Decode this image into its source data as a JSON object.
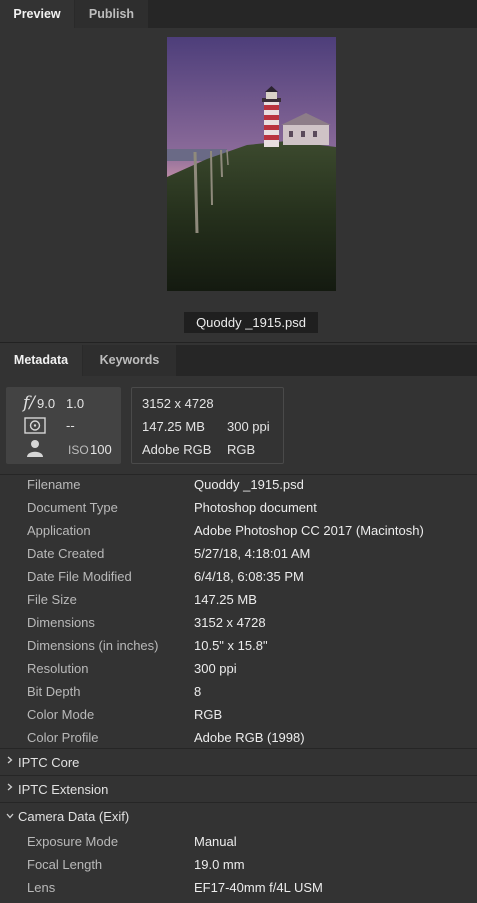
{
  "top_tabs": {
    "preview": "Preview",
    "publish": "Publish"
  },
  "preview": {
    "filename": "Quoddy _1915.psd"
  },
  "meta_tabs": {
    "metadata": "Metadata",
    "keywords": "Keywords"
  },
  "summary": {
    "fstop_icon": "f/",
    "aperture": "9.0",
    "exposure": "1.0",
    "metering": "--",
    "iso_label": "ISO",
    "iso_value": "100",
    "dimensions": "3152 x 4728",
    "size": "147.25 MB",
    "resolution": "300 ppi",
    "profile": "Adobe RGB",
    "mode": "RGB"
  },
  "file_properties": [
    {
      "key": "Filename",
      "value": "Quoddy _1915.psd"
    },
    {
      "key": "Document Type",
      "value": "Photoshop document"
    },
    {
      "key": "Application",
      "value": "Adobe Photoshop CC 2017 (Macintosh)"
    },
    {
      "key": "Date Created",
      "value": "5/27/18, 4:18:01 AM"
    },
    {
      "key": "Date File Modified",
      "value": "6/4/18, 6:08:35 PM"
    },
    {
      "key": "File Size",
      "value": "147.25 MB"
    },
    {
      "key": "Dimensions",
      "value": "3152 x 4728"
    },
    {
      "key": "Dimensions (in inches)",
      "value": "10.5\" x 15.8\""
    },
    {
      "key": "Resolution",
      "value": "300 ppi"
    },
    {
      "key": "Bit Depth",
      "value": "8"
    },
    {
      "key": "Color Mode",
      "value": "RGB"
    },
    {
      "key": "Color Profile",
      "value": "Adobe RGB (1998)"
    }
  ],
  "sections": {
    "iptc_core": "IPTC Core",
    "iptc_extension": "IPTC Extension",
    "camera_data": "Camera Data (Exif)"
  },
  "camera_data": [
    {
      "key": "Exposure Mode",
      "value": "Manual"
    },
    {
      "key": "Focal Length",
      "value": "19.0 mm"
    },
    {
      "key": "Lens",
      "value": "EF17-40mm f/4L USM"
    }
  ]
}
